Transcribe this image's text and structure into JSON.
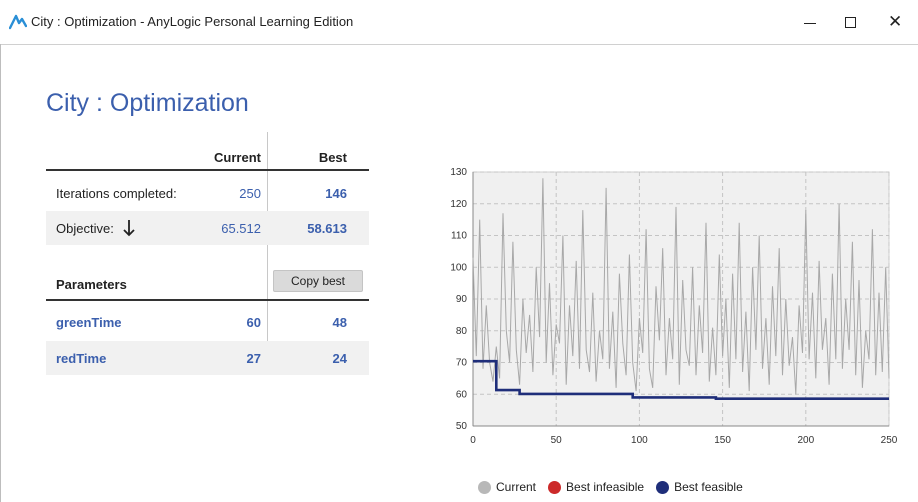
{
  "window": {
    "title": "City : Optimization - AnyLogic Personal Learning Edition",
    "app_icon": "anylogic-logo-icon",
    "minimize_icon": "minimize-icon",
    "maximize_icon": "maximize-icon",
    "close_icon": "close-icon"
  },
  "page": {
    "title": "City : Optimization"
  },
  "table": {
    "col_current": "Current",
    "col_best": "Best",
    "iterations": {
      "label": "Iterations completed:",
      "current": "250",
      "best": "146"
    },
    "objective": {
      "label": "Objective:",
      "direction_icon": "arrow-down-icon",
      "current": "65.512",
      "best": "58.613"
    },
    "parameters_header": "Parameters",
    "copy_best_label": "Copy best",
    "params": [
      {
        "name": "greenTime",
        "current": "60",
        "best": "48"
      },
      {
        "name": "redTime",
        "current": "27",
        "best": "24"
      }
    ]
  },
  "colors": {
    "accent": "#3b5fad",
    "current_series": "#a8a8a8",
    "best_infeasible": "#cc2a2a",
    "best_feasible": "#1f2e7a"
  },
  "chart_data": {
    "type": "line",
    "xlim": [
      0,
      250
    ],
    "ylim": [
      50,
      130
    ],
    "x_ticks": [
      0,
      50,
      100,
      150,
      200,
      250
    ],
    "y_ticks": [
      50,
      60,
      70,
      80,
      90,
      100,
      110,
      120,
      130
    ],
    "grid": true,
    "legend_position": "bottom",
    "series": [
      {
        "name": "Current",
        "x": [
          0,
          2,
          4,
          6,
          8,
          10,
          12,
          14,
          16,
          18,
          20,
          22,
          24,
          26,
          28,
          30,
          32,
          34,
          36,
          38,
          40,
          42,
          44,
          46,
          48,
          50,
          52,
          54,
          56,
          58,
          60,
          62,
          64,
          66,
          68,
          70,
          72,
          74,
          76,
          78,
          80,
          82,
          84,
          86,
          88,
          90,
          92,
          94,
          96,
          98,
          100,
          102,
          104,
          106,
          108,
          110,
          112,
          114,
          116,
          118,
          120,
          122,
          124,
          126,
          128,
          130,
          132,
          134,
          136,
          138,
          140,
          142,
          144,
          146,
          148,
          150,
          152,
          154,
          156,
          158,
          160,
          162,
          164,
          166,
          168,
          170,
          172,
          174,
          176,
          178,
          180,
          182,
          184,
          186,
          188,
          190,
          192,
          194,
          196,
          198,
          200,
          202,
          204,
          206,
          208,
          210,
          212,
          214,
          216,
          218,
          220,
          222,
          224,
          226,
          228,
          230,
          232,
          234,
          236,
          238,
          240,
          242,
          244,
          246,
          248,
          250
        ],
        "y": [
          103,
          72,
          115,
          68,
          88,
          70,
          64,
          75,
          65,
          117,
          80,
          70,
          108,
          74,
          63,
          90,
          73,
          85,
          67,
          100,
          78,
          128,
          70,
          95,
          66,
          82,
          76,
          110,
          63,
          88,
          72,
          102,
          68,
          118,
          74,
          67,
          92,
          64,
          80,
          71,
          125,
          68,
          86,
          62,
          98,
          76,
          66,
          104,
          70,
          61,
          84,
          73,
          112,
          68,
          62,
          94,
          77,
          106,
          66,
          84,
          71,
          119,
          63,
          96,
          74,
          69,
          100,
          66,
          88,
          73,
          114,
          64,
          81,
          66,
          104,
          72,
          90,
          62,
          98,
          71,
          114,
          67,
          86,
          61,
          100,
          74,
          110,
          68,
          84,
          63,
          94,
          72,
          106,
          66,
          90,
          69,
          78,
          60,
          88,
          73,
          118,
          71,
          92,
          65,
          102,
          74,
          84,
          63,
          98,
          71,
          120,
          68,
          90,
          74,
          108,
          66,
          96,
          62,
          80,
          71,
          112,
          66,
          92,
          67,
          100,
          65
        ]
      },
      {
        "name": "Best infeasible",
        "x": [],
        "y": []
      },
      {
        "name": "Best feasible",
        "x": [
          0,
          14,
          14,
          28,
          28,
          96,
          96,
          146,
          146,
          250
        ],
        "y": [
          70.4,
          70.4,
          61.3,
          61.3,
          60.1,
          60.1,
          59.0,
          59.0,
          58.6,
          58.6
        ]
      }
    ]
  }
}
